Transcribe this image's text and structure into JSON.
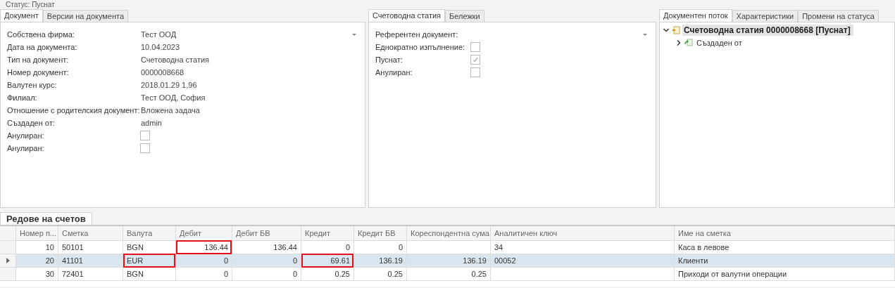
{
  "status_text": "Статус: Пуснат",
  "document_panel": {
    "tabs": [
      {
        "label": "Документ",
        "selected": true
      },
      {
        "label": "Версии на документа",
        "selected": false
      }
    ],
    "fields": [
      {
        "label": "Собствена фирма:",
        "kind": "dropdown",
        "value": "Тест ООД"
      },
      {
        "label": "Дата на документа:",
        "kind": "text",
        "value": "10.04.2023"
      },
      {
        "label": "Тип на документ:",
        "kind": "text",
        "value": "Счетоводна статия"
      },
      {
        "label": "Номер документ:",
        "kind": "text",
        "value": "0000008668"
      },
      {
        "label": "Валутен курс:",
        "kind": "text",
        "value": "2018.01.29 1,96"
      },
      {
        "label": "Филиал:",
        "kind": "text",
        "value": "Тест ООД, София"
      },
      {
        "label": "Отношение с родителския документ:",
        "kind": "text",
        "value": "Вложена задача"
      },
      {
        "label": "Създаден от:",
        "kind": "text",
        "value": "admin"
      },
      {
        "label": "Анулиран:",
        "kind": "checkbox",
        "checked": false
      },
      {
        "label": "Анулиран:",
        "kind": "checkbox",
        "checked": false
      }
    ]
  },
  "entry_panel": {
    "tabs": [
      {
        "label": "Счетоводна статия",
        "selected": true
      },
      {
        "label": "Бележки",
        "selected": false
      }
    ],
    "fields": [
      {
        "label": "Референтен документ:",
        "kind": "dropdown"
      },
      {
        "label": "Еднократно изпълнение:",
        "kind": "checkbox",
        "checked": false
      },
      {
        "label": "Пуснат:",
        "kind": "checkbox",
        "checked": true
      },
      {
        "label": "Анулиран:",
        "kind": "checkbox",
        "checked": false
      }
    ]
  },
  "flow_panel": {
    "tabs": [
      {
        "label": "Документен поток",
        "selected": true
      },
      {
        "label": "Характеристики",
        "selected": false
      },
      {
        "label": "Промени на статуса",
        "selected": false
      }
    ],
    "tree": [
      {
        "label": "Счетоводна статия 0000008668 [Пуснат]",
        "kind": "document",
        "selected": true,
        "expanded": true,
        "children": [
          {
            "label": "Създаден от",
            "kind": "link",
            "selected": false,
            "expanded": false
          }
        ]
      }
    ]
  },
  "lines_panel": {
    "tabs": [
      {
        "label": "Редове на счетов",
        "selected": true
      }
    ],
    "table": {
      "columns": [
        {
          "label": "Номер п...",
          "kind": "number"
        },
        {
          "label": "Сметка",
          "kind": "text"
        },
        {
          "label": "Валута",
          "kind": "text"
        },
        {
          "label": "Дебит",
          "kind": "number"
        },
        {
          "label": "Дебит БВ",
          "kind": "number"
        },
        {
          "label": "Кредит",
          "kind": "number"
        },
        {
          "label": "Кредит БВ",
          "kind": "number"
        },
        {
          "label": "Кореспондентна сума",
          "kind": "number"
        },
        {
          "label": "Аналитичен ключ",
          "kind": "text"
        },
        {
          "label": "Име на сметка",
          "kind": "text"
        }
      ],
      "rows": [
        {
          "selected": false,
          "cells": [
            {
              "text": "10",
              "marked": false
            },
            {
              "text": "50101",
              "marked": false
            },
            {
              "text": "BGN",
              "marked": false
            },
            {
              "text": "136.44",
              "marked": true
            },
            {
              "text": "136.44",
              "marked": false
            },
            {
              "text": "0",
              "marked": false
            },
            {
              "text": "0",
              "marked": false
            },
            {
              "marked": false
            },
            {
              "text": "34",
              "marked": false
            },
            {
              "text": "Каса в левове",
              "marked": false
            }
          ]
        },
        {
          "selected": true,
          "cells": [
            {
              "text": "20",
              "marked": false
            },
            {
              "text": "41101",
              "marked": false
            },
            {
              "text": "EUR",
              "marked": true
            },
            {
              "text": "0",
              "marked": false
            },
            {
              "text": "0",
              "marked": false
            },
            {
              "text": "69.61",
              "marked": true
            },
            {
              "text": "136.19",
              "marked": false
            },
            {
              "text": "136.19",
              "marked": false
            },
            {
              "text": "00052",
              "marked": false
            },
            {
              "text": "Клиенти",
              "marked": false
            }
          ]
        },
        {
          "selected": false,
          "cells": [
            {
              "text": "30",
              "marked": false
            },
            {
              "text": "72401",
              "marked": false
            },
            {
              "text": "BGN",
              "marked": false
            },
            {
              "text": "0",
              "marked": false
            },
            {
              "text": "0",
              "marked": false
            },
            {
              "text": "0.25",
              "marked": false
            },
            {
              "text": "0.25",
              "marked": false
            },
            {
              "text": "0.25",
              "marked": false
            },
            {
              "marked": false
            },
            {
              "text": "Приходи от валутни операции",
              "marked": false
            }
          ]
        }
      ]
    }
  }
}
